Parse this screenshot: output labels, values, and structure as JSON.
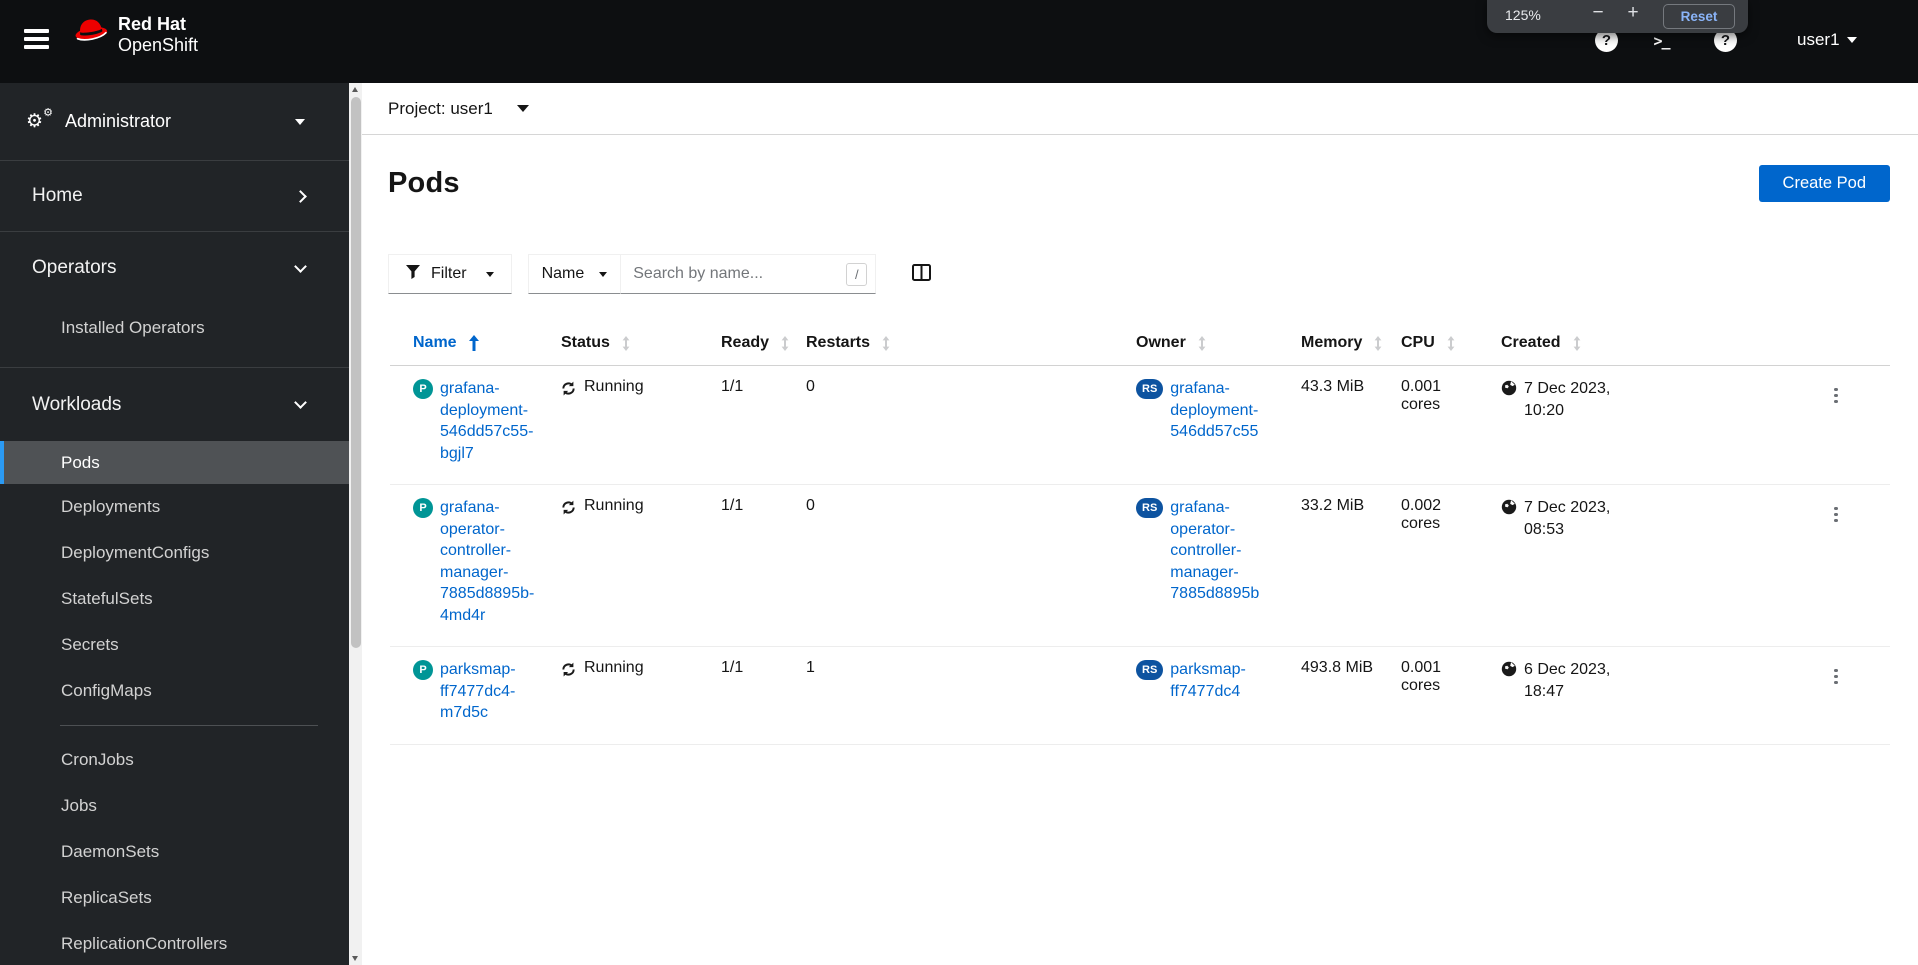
{
  "masthead": {
    "brand_line1": "Red Hat",
    "brand_line2": "OpenShift",
    "user": "user1",
    "zoom_popup": {
      "level": "125%",
      "minus": "−",
      "plus": "+",
      "reset": "Reset"
    },
    "terminal_glyph": ">_",
    "info_glyph": "?",
    "help_glyph": "?"
  },
  "sidebar": {
    "perspective": "Administrator",
    "home": "Home",
    "operators": "Operators",
    "operators_items": [
      "Installed Operators"
    ],
    "workloads": "Workloads",
    "workloads_items": [
      "Pods",
      "Deployments",
      "DeploymentConfigs",
      "StatefulSets",
      "Secrets",
      "ConfigMaps",
      "CronJobs",
      "Jobs",
      "DaemonSets",
      "ReplicaSets",
      "ReplicationControllers"
    ],
    "selected_item": "Pods"
  },
  "content": {
    "project_bar": "Project: user1",
    "page_title": "Pods",
    "create_button": "Create Pod",
    "toolbar": {
      "filter": "Filter",
      "name_filter": "Name",
      "search_placeholder": "Search by name...",
      "shortcut_key": "/"
    },
    "table": {
      "columns": [
        "Name",
        "Status",
        "Ready",
        "Restarts",
        "Owner",
        "Memory",
        "CPU",
        "Created"
      ],
      "pod_badge": "P",
      "owner_badge": "RS",
      "rows": [
        {
          "name_lines": [
            "grafana-deployment-",
            "546dd57c55-bgjl7"
          ],
          "status": "Running",
          "ready": "1/1",
          "restarts": "0",
          "owner_lines": [
            "grafana-deployment-",
            "546dd57c55"
          ],
          "memory": "43.3 MiB",
          "cpu": "0.001 cores",
          "created_lines": [
            "7 Dec 2023,",
            "10:20"
          ]
        },
        {
          "name_lines": [
            "grafana-operator-",
            "controller-manager-",
            "7885d8895b-4md4r"
          ],
          "status": "Running",
          "ready": "1/1",
          "restarts": "0",
          "owner_lines": [
            "grafana-operator-",
            "controller-manager-",
            "7885d8895b"
          ],
          "memory": "33.2 MiB",
          "cpu": "0.002 cores",
          "created_lines": [
            "7 Dec 2023,",
            "08:53"
          ]
        },
        {
          "name_lines": [
            "parksmap-ff7477dc4-",
            "m7d5c"
          ],
          "status": "Running",
          "ready": "1/1",
          "restarts": "1",
          "owner_lines": [
            "parksmap-ff7477dc4"
          ],
          "memory": "493.8 MiB",
          "cpu": "0.001 cores",
          "created_lines": [
            "6 Dec 2023,",
            "18:47"
          ]
        }
      ]
    }
  },
  "colors": {
    "accent_blue": "#0066cc",
    "link_blue": "#0066cc",
    "pod_badge": "#009596",
    "replicaset_badge": "#0d53a0",
    "masthead_bg": "#0d0f11",
    "sidebar_bg": "#212427",
    "selected_nav_bg": "#4f5255",
    "selected_nav_indicator": "#2b9af3"
  }
}
